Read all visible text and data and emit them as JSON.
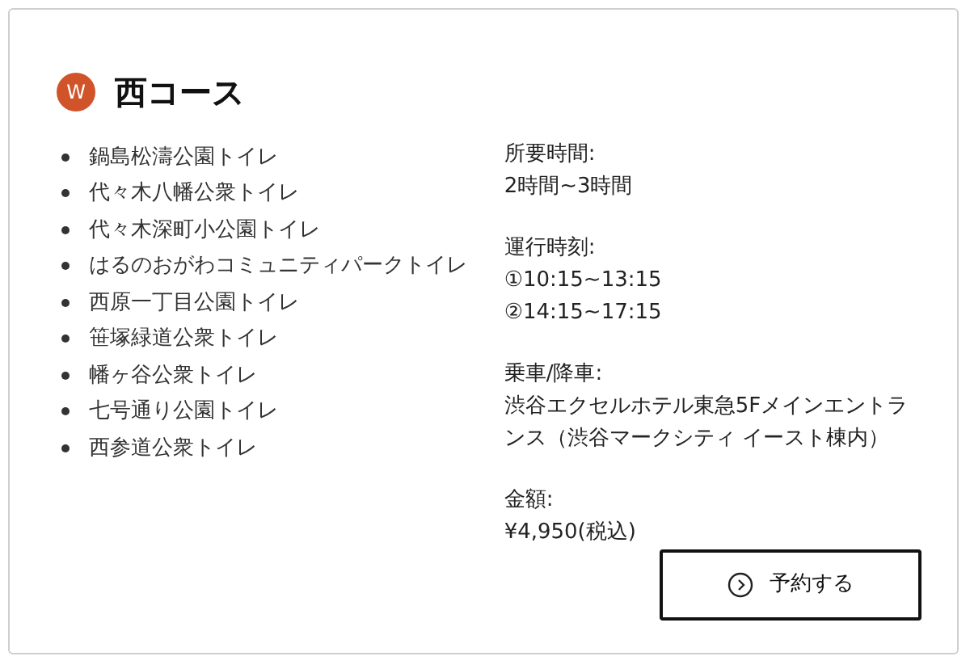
{
  "course": {
    "badge": "W",
    "title": "西コース"
  },
  "stops": [
    "鍋島松濤公園トイレ",
    "代々木八幡公衆トイレ",
    "代々木深町小公園トイレ",
    "はるのおがわコミュニティパークトイレ",
    "西原一丁目公園トイレ",
    "笹塚緑道公衆トイレ",
    "幡ヶ谷公衆トイレ",
    "七号通り公園トイレ",
    "西参道公衆トイレ"
  ],
  "details": [
    {
      "label": "所要時間:",
      "lines": [
        "2時間~3時間"
      ]
    },
    {
      "label": "運行時刻:",
      "lines": [
        "①10:15~13:15",
        "②14:15~17:15"
      ]
    },
    {
      "label": "乗車/降車:",
      "lines": [
        "渋谷エクセルホテル東急5Fメインエントランス（渋谷マークシティ イースト棟内）"
      ]
    },
    {
      "label": "金額:",
      "lines": [
        "¥4,950(税込)"
      ]
    }
  ],
  "reserve_button": {
    "label": "予約する"
  }
}
